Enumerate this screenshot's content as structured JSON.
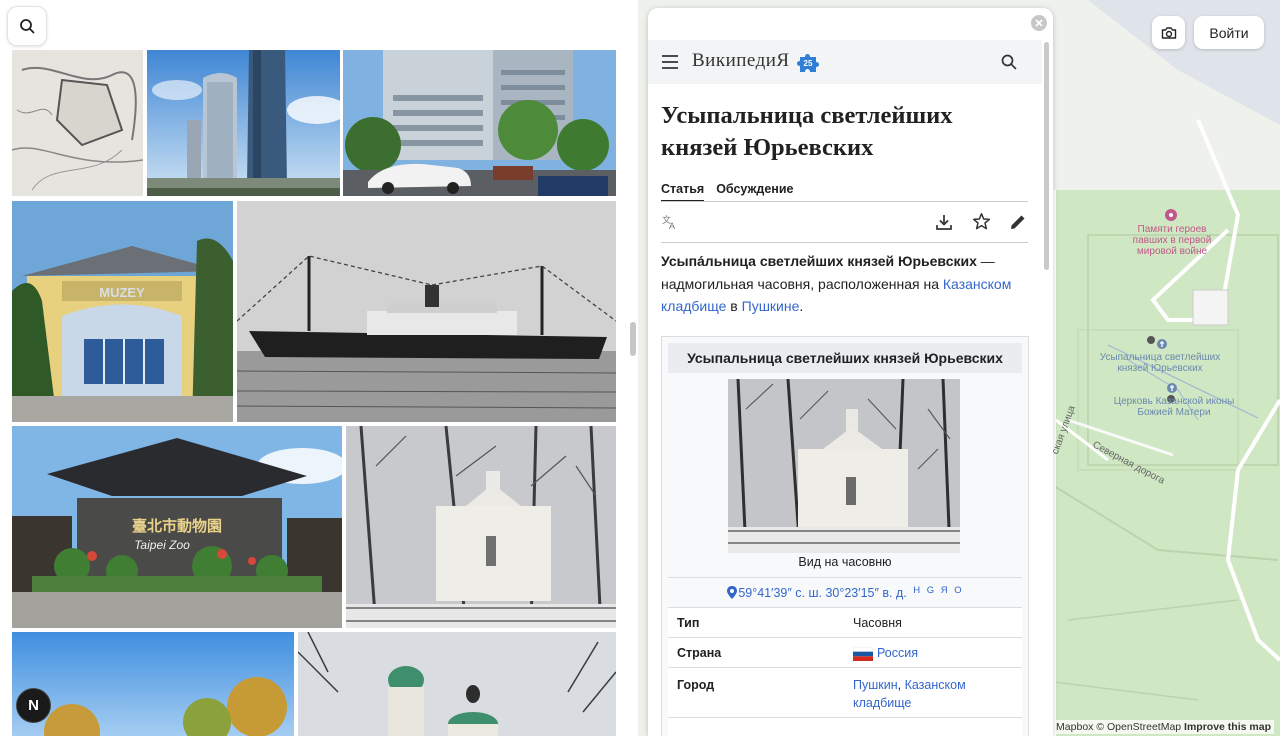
{
  "gallery": {
    "tiles": [
      {
        "name": "old-map-photo"
      },
      {
        "name": "skyscrapers-photo"
      },
      {
        "name": "office-building-photo"
      },
      {
        "name": "muzey-building-photo",
        "sign": "MUZEY"
      },
      {
        "name": "steamship-photo"
      },
      {
        "name": "taipei-zoo-photo",
        "sign": "臺北市動物園",
        "sign_en": "Taipei Zoo"
      },
      {
        "name": "chapel-winter-photo"
      },
      {
        "name": "autumn-trees-photo"
      },
      {
        "name": "church-domes-photo"
      }
    ],
    "badge_letter": "N"
  },
  "map": {
    "poi_memorial": "Памяти героев павших в первой мировой войне",
    "poi_chapel": "Усыпальница светлейших князей Юрьевских",
    "poi_church": "Церковь Казанской иконы Божией Матери",
    "road_north": "Северная дорога",
    "road_side": "ская улица",
    "attribution": {
      "mapbox": "© Mapbox",
      "osm": "© OpenStreetMap",
      "improve": "Improve this map"
    }
  },
  "top_buttons": {
    "login": "Войти"
  },
  "wiki": {
    "logo_text": "ВикипедиЯ",
    "logo_badge": "25",
    "title": "Усыпальница светлейших князей Юрьевских",
    "tab_article": "Статья",
    "tab_talk": "Обсуждение",
    "lead_bold": "Усыпа́льница светлейших князей Юрьевских",
    "lead_text1": " — надмогильная часовня, расположенная на ",
    "link_kazan": "Казанском кладбище",
    "lead_text2": " в ",
    "link_pushkin": "Пушкине",
    "lead_end": ".",
    "infobox": {
      "title": "Усыпальница светлейших князей Юрьевских",
      "caption": "Вид на часовню",
      "coords": "59°41′39″ с. ш. 30°23′15″ в. д.",
      "coord_links": "H G Я O",
      "rows": [
        {
          "label": "Тип",
          "value": "Часовня"
        },
        {
          "label": "Страна",
          "value": "Россия"
        },
        {
          "label": "Город",
          "value": "Пушкин",
          "sep": ", ",
          "value2": "Казанском",
          "value3": "кладбище"
        }
      ]
    }
  },
  "colors": {
    "link": "#3366cc",
    "map_green": "#cfe7c2",
    "poi_pink": "#c2588a",
    "poi_blue": "#6c8ab0"
  }
}
